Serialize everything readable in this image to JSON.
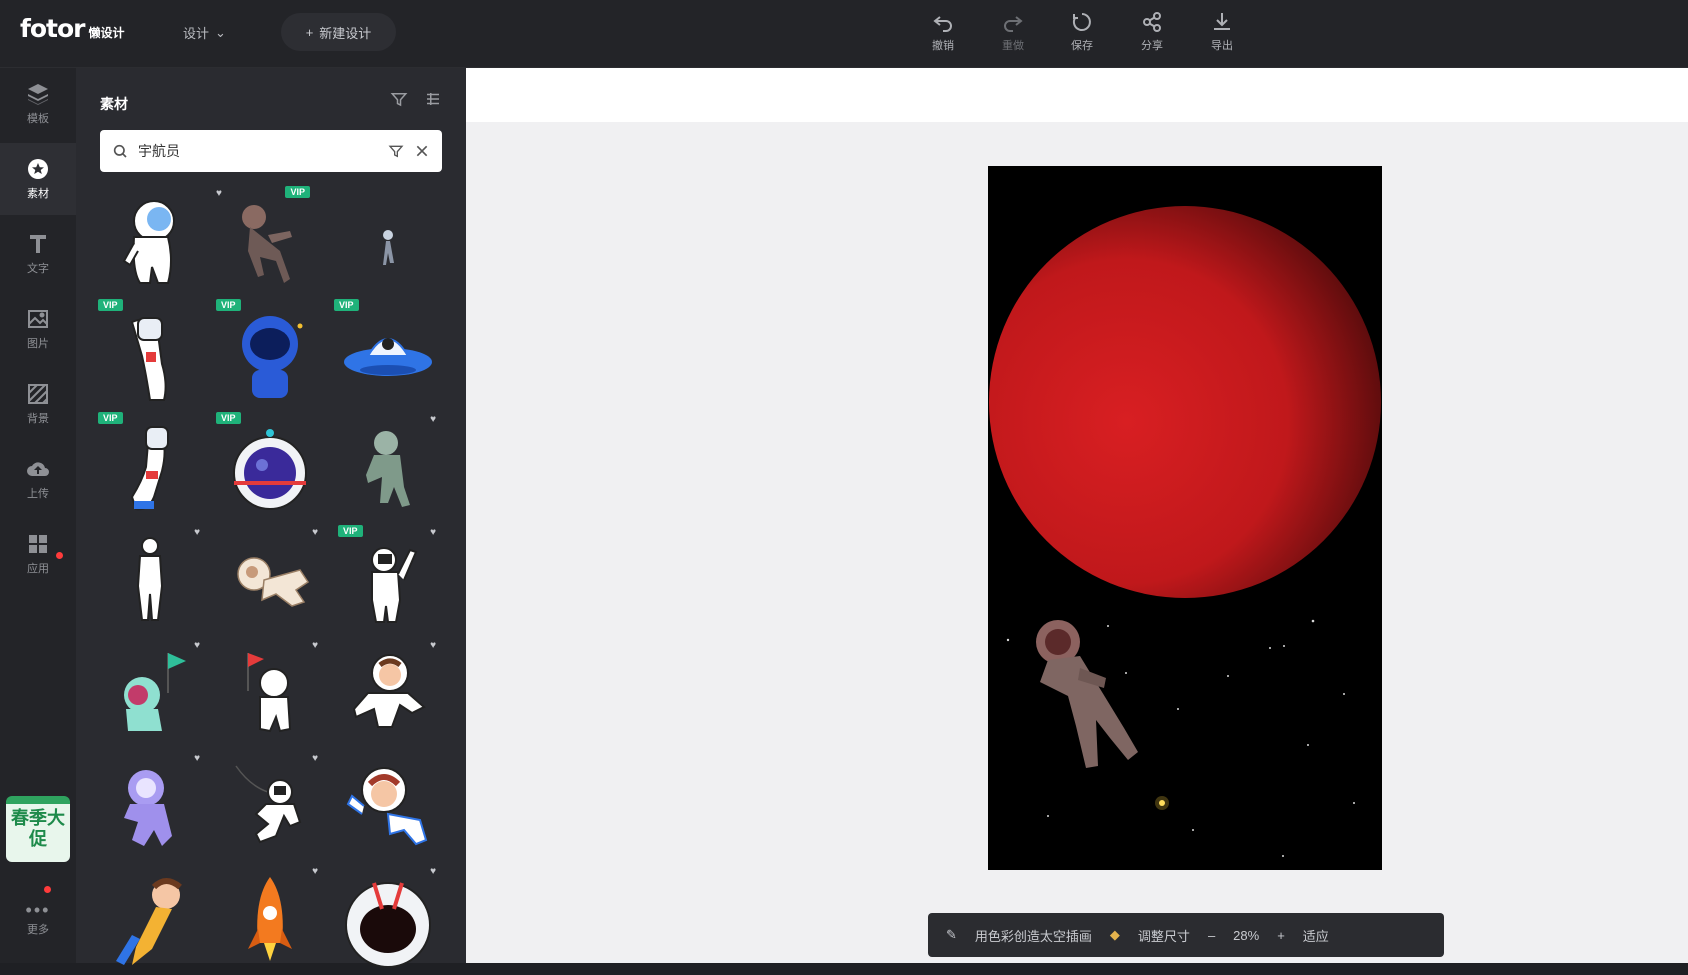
{
  "header": {
    "logo": "fotor",
    "logo_sub": "懒设计",
    "design_menu": "设计",
    "new_design": "新建设计",
    "tools": [
      {
        "label": "撤销",
        "icon": "undo-icon",
        "dim": false
      },
      {
        "label": "重做",
        "icon": "redo-icon",
        "dim": true
      },
      {
        "label": "保存",
        "icon": "save-icon",
        "dim": false
      },
      {
        "label": "分享",
        "icon": "share-icon",
        "dim": false
      },
      {
        "label": "导出",
        "icon": "download-icon",
        "dim": false
      }
    ]
  },
  "rail": {
    "items": [
      {
        "label": "模板",
        "icon": "template-icon"
      },
      {
        "label": "素材",
        "icon": "elements-icon",
        "active": true
      },
      {
        "label": "文字",
        "icon": "text-icon"
      },
      {
        "label": "图片",
        "icon": "image-icon"
      },
      {
        "label": "背景",
        "icon": "background-icon"
      },
      {
        "label": "上传",
        "icon": "upload-icon"
      },
      {
        "label": "应用",
        "icon": "apps-icon"
      }
    ],
    "promo": "春季大促",
    "more_label": "更多"
  },
  "panel": {
    "title": "素材",
    "search_value": "宇航员",
    "badge": "VIP"
  },
  "bottom_bar": {
    "hint": "用色彩创造太空插画",
    "resize": "调整尺寸",
    "zoom": "28%",
    "minus": "–",
    "plus": "+",
    "fit": "适应"
  },
  "colors": {
    "accent": "#1fb27a",
    "planet": "#d41f1f",
    "vip_gold": "#e3b24d"
  }
}
